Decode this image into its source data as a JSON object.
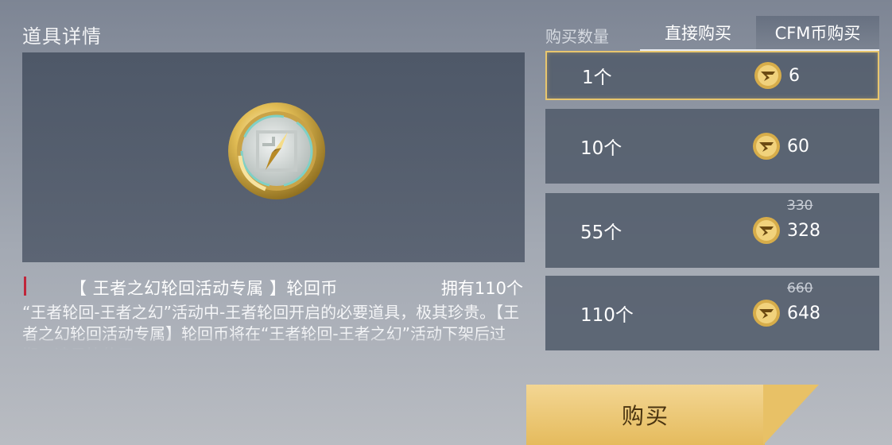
{
  "header": {
    "title": "道具详情"
  },
  "item": {
    "name": "【 王者之幻轮回活动专属 】轮回币",
    "owned": "拥有110个",
    "description": "“王者轮回-王者之幻”活动中-王者轮回开启的必要道具，极其珍贵。【王者之幻轮回活动专属】轮回币将在“王者轮回-王者之幻”活动下架后过期，请尽快使用。",
    "icon": "compass-coin-icon"
  },
  "purchase": {
    "qty_header": "购买数量",
    "tabs": [
      {
        "label": "直接购买",
        "active": false
      },
      {
        "label": "CFM币购买",
        "active": true
      }
    ],
    "options": [
      {
        "qty": "1个",
        "price": "6",
        "original_price": "",
        "selected": true
      },
      {
        "qty": "10个",
        "price": "60",
        "original_price": "",
        "selected": false
      },
      {
        "qty": "55个",
        "price": "328",
        "original_price": "330",
        "selected": false
      },
      {
        "qty": "110个",
        "price": "648",
        "original_price": "660",
        "selected": false
      }
    ],
    "currency_icon": "cfm-coin-icon",
    "buy_label": "购买"
  },
  "colors": {
    "accent_gold": "#e8c66e",
    "panel": "#525c6b",
    "marker_red": "#c0263a"
  }
}
